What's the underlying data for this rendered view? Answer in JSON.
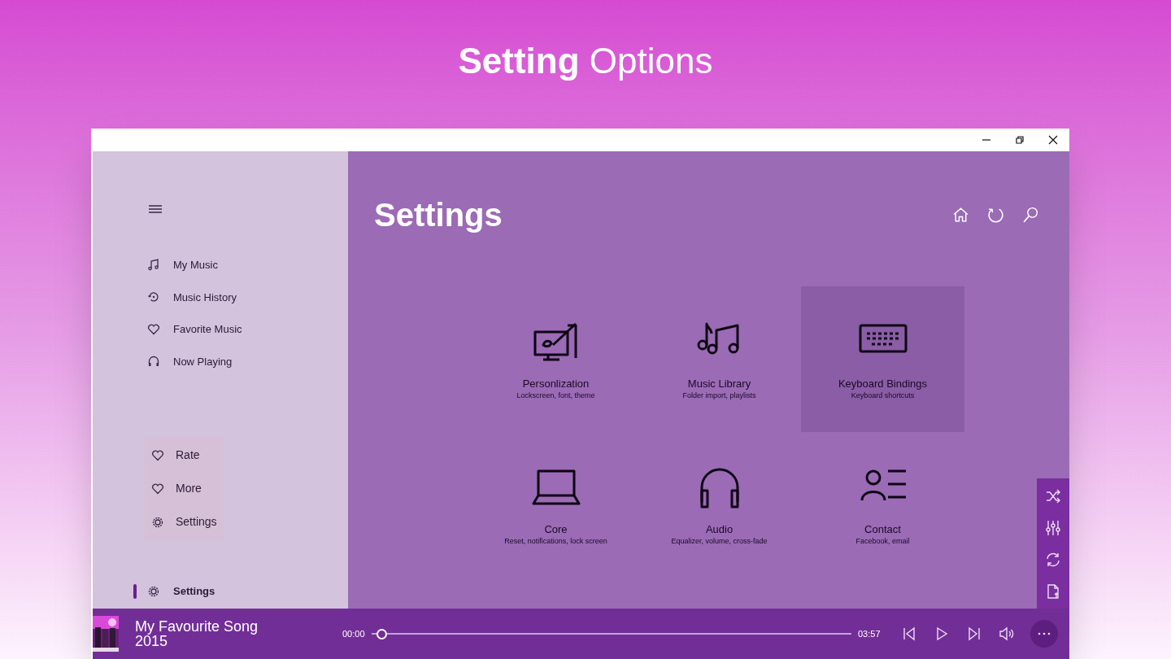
{
  "banner": {
    "title": "**Setting** Options"
  },
  "sidebar": {
    "nav_items": [
      {
        "label": "My Music",
        "selected": false
      },
      {
        "label": "Music History",
        "selected": false
      },
      {
        "label": "Favorite Music",
        "selected": false
      },
      {
        "label": "Now Playing",
        "selected": false
      }
    ],
    "secondary_items": [
      {
        "label": "Rate"
      },
      {
        "label": "More"
      },
      {
        "label": "Settings"
      }
    ],
    "footer_item": {
      "label": "Settings",
      "selected": true
    }
  },
  "main": {
    "title": "Settings",
    "tiles": [
      {
        "title": "Personlization",
        "subtitle": "Lockscreen, font, theme",
        "selected": false
      },
      {
        "title": "Music Library",
        "subtitle": "Folder import, playlists",
        "selected": false
      },
      {
        "title": "Keyboard Bindings",
        "subtitle": "Keyboard shortcuts",
        "selected": true
      },
      {
        "title": "Core",
        "subtitle": "Reset, notifications, lock screen",
        "selected": false
      },
      {
        "title": "Audio",
        "subtitle": "Equalizer, volume, cross-fade",
        "selected": false
      },
      {
        "title": "Contact",
        "subtitle": "Facebook, email",
        "selected": false
      }
    ]
  },
  "player": {
    "song": "My Favourite Song",
    "year": "2015",
    "elapsed": "00:00",
    "duration": "03:57",
    "level": 0.01
  }
}
